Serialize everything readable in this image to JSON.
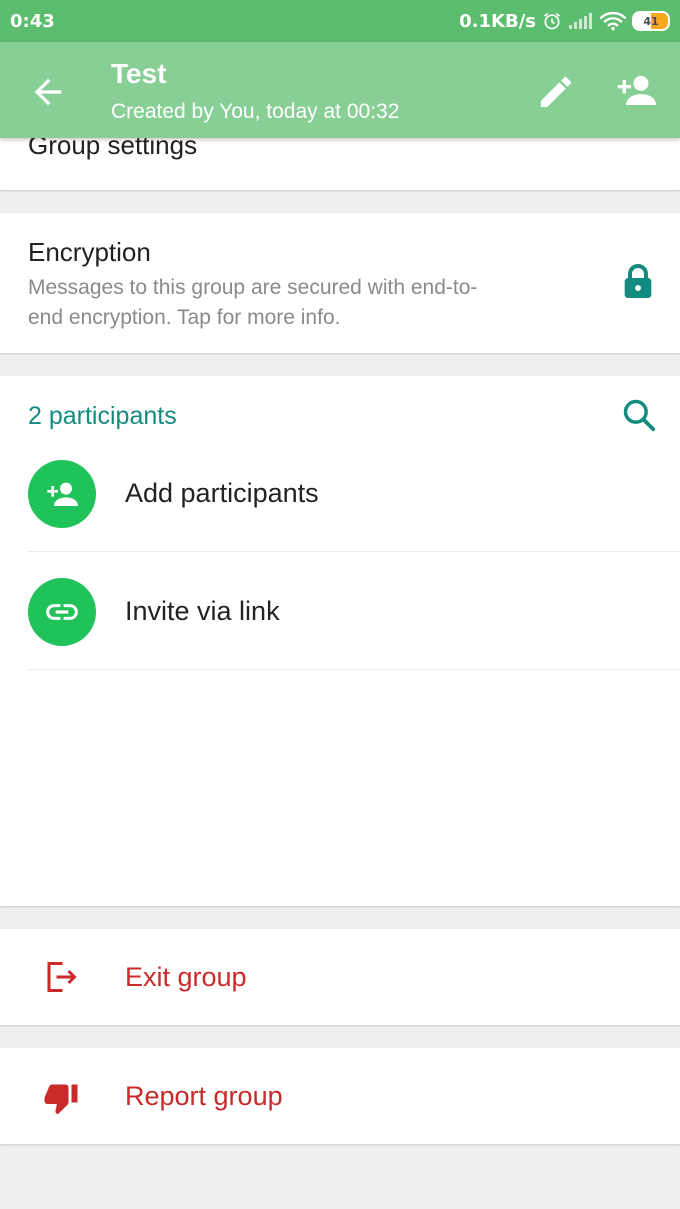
{
  "status_bar": {
    "time": "0:43",
    "network_speed": "0.1KB/s",
    "battery_level": "41"
  },
  "app_bar": {
    "title": "Test",
    "subtitle": "Created by You, today at 00:32"
  },
  "group_settings": {
    "label": "Group settings"
  },
  "encryption": {
    "title": "Encryption",
    "description_line1": "Messages to this group are secured with end-to-",
    "description_line2": "end encryption. Tap for more info."
  },
  "participants": {
    "count_label": "2 participants",
    "add_label": "Add participants",
    "invite_label": "Invite via link"
  },
  "actions": {
    "exit_label": "Exit group",
    "report_label": "Report group"
  },
  "colors": {
    "status_bar": "#5dbd6e",
    "app_bar": "#88cf96",
    "accent_teal": "#128c7e",
    "accent_green": "#1fc35a",
    "danger_red": "#c92a2a"
  }
}
